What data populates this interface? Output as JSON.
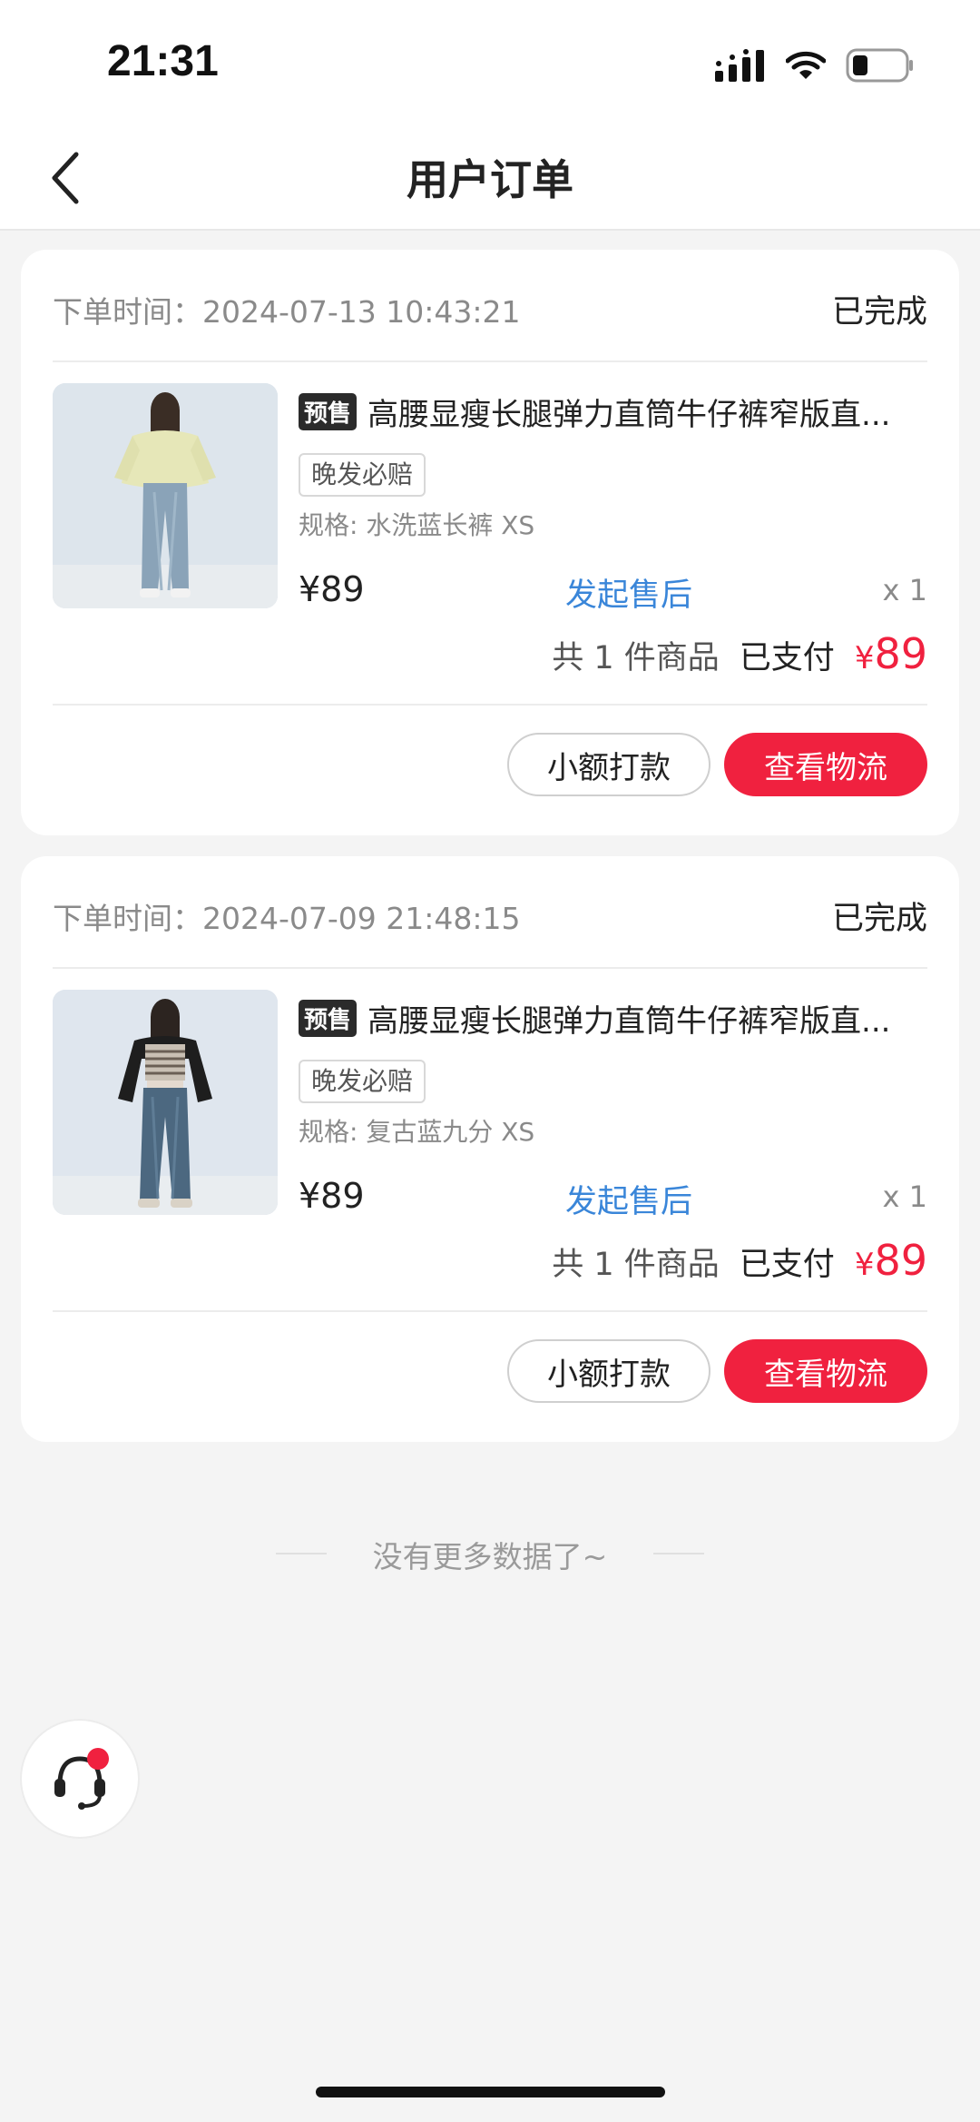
{
  "status_bar": {
    "time": "21:31"
  },
  "header": {
    "title": "用户订单",
    "back_icon": "chevron-left-icon"
  },
  "orders": [
    {
      "time_label": "下单时间：2024-07-13 10:43:21",
      "status": "已完成",
      "presale_tag": "预售",
      "product_title": "高腰显瘦长腿弹力直筒牛仔裤窄版直...",
      "service_tag": "晚发必赔",
      "spec": "规格: 水洗蓝长裤 XS",
      "price": "¥89",
      "after_sale": "发起售后",
      "quantity": "x 1",
      "item_count": "共 1 件商品",
      "paid_label": "已支付",
      "paid_currency": "¥",
      "paid_amount": "89",
      "buttons": {
        "small_payment": "小额打款",
        "view_logistics": "查看物流"
      }
    },
    {
      "time_label": "下单时间：2024-07-09 21:48:15",
      "status": "已完成",
      "presale_tag": "预售",
      "product_title": "高腰显瘦长腿弹力直筒牛仔裤窄版直...",
      "service_tag": "晚发必赔",
      "spec": "规格: 复古蓝九分 XS",
      "price": "¥89",
      "after_sale": "发起售后",
      "quantity": "x 1",
      "item_count": "共 1 件商品",
      "paid_label": "已支付",
      "paid_currency": "¥",
      "paid_amount": "89",
      "buttons": {
        "small_payment": "小额打款",
        "view_logistics": "查看物流"
      }
    }
  ],
  "footer": {
    "no_more": "没有更多数据了~"
  },
  "colors": {
    "accent_red": "#f0213f",
    "link_blue": "#3a86d9",
    "background": "#f4f4f4"
  }
}
